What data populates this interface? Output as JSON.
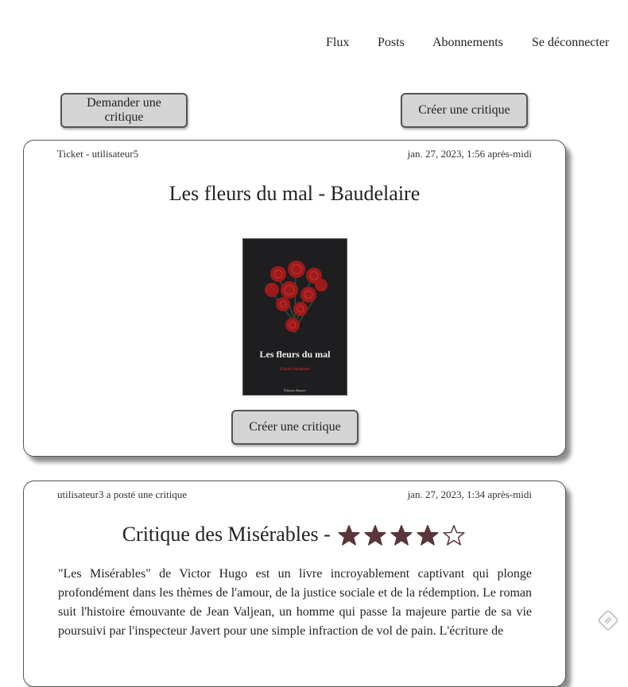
{
  "nav": {
    "items": [
      {
        "label": "Flux"
      },
      {
        "label": "Posts"
      },
      {
        "label": "Abonnements"
      },
      {
        "label": "Se déconnecter"
      }
    ]
  },
  "actions": {
    "request_review_label": "Demander une critique",
    "create_review_label": "Créer une critique"
  },
  "feed": {
    "ticket": {
      "header": "Ticket - utilisateur5",
      "date": "jan. 27, 2023, 1:56 après-midi",
      "title": "Les fleurs du mal - Baudelaire",
      "cover": {
        "title": "Les fleurs du mal",
        "author": "Charles Baudelaire",
        "publisher": "Éditions Daunort"
      },
      "button_label": "Créer une critique"
    },
    "review": {
      "header": "utilisateur3 a posté une critique",
      "date": "jan. 27, 2023, 1:34 après-midi",
      "title": "Critique des Misérables -",
      "rating": 4,
      "rating_max": 5,
      "star_color": "#5a353b",
      "body": "\"Les Misérables\" de Victor Hugo est un livre incroyablement captivant qui plonge profondément dans les thèmes de l'amour, de la justice sociale et de la rédemption. Le roman suit l'histoire émouvante de Jean Valjean, un homme qui passe la majeure partie de sa vie poursuivi par l'inspecteur Javert pour une simple infraction de vol de pain. L'écriture de"
    }
  }
}
